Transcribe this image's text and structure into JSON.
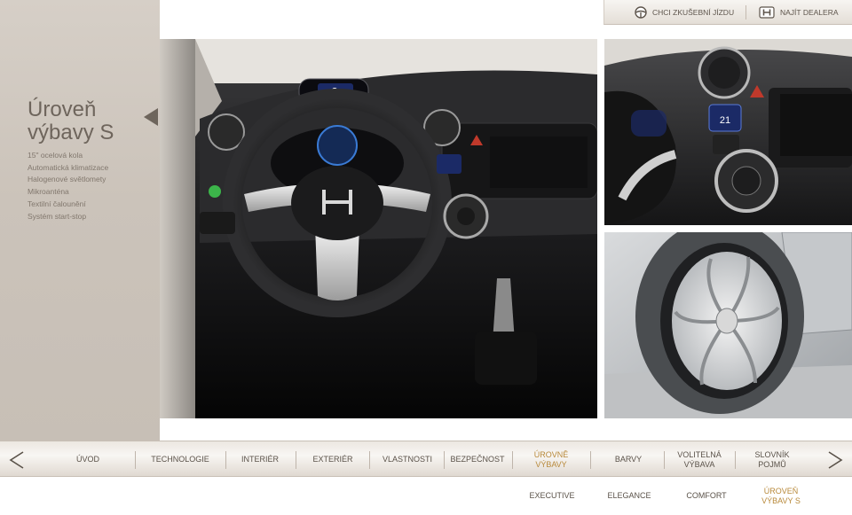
{
  "side": {
    "title": "Úroveň výbavy S",
    "features": [
      "15\" ocelová kola",
      "Automatická klimatizace",
      "Halogenové světlomety",
      "Mikroanténa",
      "Textilní čalounění",
      "Systém start-stop"
    ]
  },
  "top_buttons": {
    "test_drive": "CHCI ZKUŠEBNÍ JÍZDU",
    "dealer": "NAJÍT DEALERA"
  },
  "nav": {
    "items": [
      {
        "label": "ÚVOD",
        "active": false
      },
      {
        "label": "TECHNOLOGIE",
        "active": false
      },
      {
        "label": "INTERIÉR",
        "active": false
      },
      {
        "label": "EXTERIÉR",
        "active": false
      },
      {
        "label": "VLASTNOSTI",
        "active": false
      },
      {
        "label": "BEZPEČNOST",
        "active": false
      },
      {
        "label": "ÚROVNĚ VÝBAVY",
        "active": true
      },
      {
        "label": "BARVY",
        "active": false
      },
      {
        "label": "VOLITELNÁ VÝBAVA",
        "active": false
      },
      {
        "label": "SLOVNÍK POJMŮ",
        "active": false
      }
    ]
  },
  "sub_nav": {
    "items": [
      {
        "label": "EXECUTIVE",
        "active": false
      },
      {
        "label": "ELEGANCE",
        "active": false
      },
      {
        "label": "COMFORT",
        "active": false
      },
      {
        "label": "ÚROVEŇ VÝBAVY S",
        "active": true
      }
    ]
  },
  "colors": {
    "accent": "#b8893a",
    "text": "#5a5249",
    "side_panel": "#cbc3ba"
  },
  "icons": {
    "steering_wheel": "steering-wheel-icon",
    "honda_logo": "honda-logo-icon",
    "prev": "chevron-left-icon",
    "next": "chevron-right-icon"
  }
}
